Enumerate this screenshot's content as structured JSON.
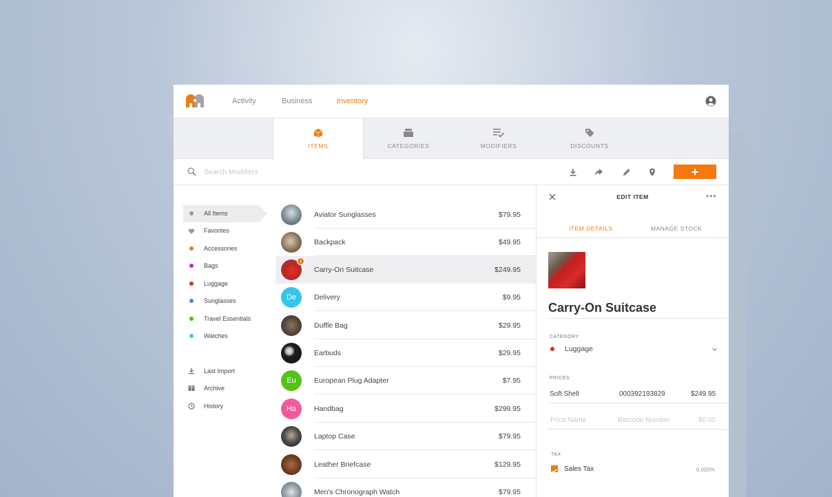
{
  "nav": {
    "links": [
      "Activity",
      "Business",
      "Inventory"
    ],
    "active": "Inventory"
  },
  "tabs": [
    {
      "label": "ITEMS",
      "icon": "box-icon",
      "active": true
    },
    {
      "label": "CATEGORIES",
      "icon": "stack-icon",
      "active": false
    },
    {
      "label": "MODIFIERS",
      "icon": "list-check-icon",
      "active": false
    },
    {
      "label": "DISCOUNTS",
      "icon": "tag-icon",
      "active": false
    }
  ],
  "search": {
    "placeholder": "Search Modifiers",
    "value": ""
  },
  "toolbar": {
    "add_label": "+"
  },
  "sidebar": {
    "categories": [
      {
        "label": "All Items",
        "color": "#9a9a9a",
        "active": true
      },
      {
        "label": "Favorites",
        "color": "#9a9a9a",
        "icon": "heart-icon"
      },
      {
        "label": "Accessories",
        "color": "#f07a10"
      },
      {
        "label": "Bags",
        "color": "#d21bd6"
      },
      {
        "label": "Luggage",
        "color": "#e0261e"
      },
      {
        "label": "Sunglasses",
        "color": "#4a84e0"
      },
      {
        "label": "Travel Essentials",
        "color": "#4cbb17"
      },
      {
        "label": "Watches",
        "color": "#3ec8e8"
      }
    ],
    "tools": [
      {
        "label": "Last Import",
        "icon": "download-icon"
      },
      {
        "label": "Archive",
        "icon": "archive-icon"
      },
      {
        "label": "History",
        "icon": "history-icon"
      }
    ]
  },
  "items": [
    {
      "name": "Aviator Sunglasses",
      "price": "$79.95",
      "avatar": "photo",
      "bg": "#7a8a96"
    },
    {
      "name": "Backpack",
      "price": "$49.95",
      "avatar": "photo",
      "bg": "#8a735c"
    },
    {
      "name": "Carry-On Suitcase",
      "price": "$249.95",
      "avatar": "photo",
      "bg": "#c42222",
      "selected": true,
      "badge": "!"
    },
    {
      "name": "Delivery",
      "price": "$9.95",
      "avatar": "De",
      "bg": "#33c6ea"
    },
    {
      "name": "Duffle Bag",
      "price": "$29.95",
      "avatar": "photo",
      "bg": "#5a4a3e"
    },
    {
      "name": "Earbuds",
      "price": "$29.95",
      "avatar": "photo",
      "bg": "#1e1e1e"
    },
    {
      "name": "European Plug Adapter",
      "price": "$7.95",
      "avatar": "Eu",
      "bg": "#55c21a"
    },
    {
      "name": "Handbag",
      "price": "$299.95",
      "avatar": "Ha",
      "bg": "#f25a9c"
    },
    {
      "name": "Laptop Case",
      "price": "$79.95",
      "avatar": "photo",
      "bg": "#4a4a4a"
    },
    {
      "name": "Leather Briefcase",
      "price": "$129.95",
      "avatar": "photo",
      "bg": "#6e3e22"
    },
    {
      "name": "Men's Chronograph Watch",
      "price": "$79.95",
      "avatar": "photo",
      "bg": "#9aa4ac"
    }
  ],
  "panel": {
    "title": "EDIT ITEM",
    "tabs": [
      "ITEM DETAILS",
      "MANAGE STOCK"
    ],
    "item_name": "Carry-On Suitcase",
    "category_label": "CATEGORY",
    "category_value": "Luggage",
    "category_color": "#e0261e",
    "prices_label": "PRICES",
    "price_row": {
      "name": "Soft Shell",
      "barcode": "000392193829",
      "price": "$249.95"
    },
    "price_placeholders": {
      "name": "Price Name",
      "barcode": "Barcode Number",
      "price": "$0.00"
    },
    "tax_label": "TAX",
    "tax": {
      "name": "Sales Tax",
      "rate": "6.000%",
      "checked": true
    }
  },
  "colors": {
    "accent": "#f07a10"
  }
}
